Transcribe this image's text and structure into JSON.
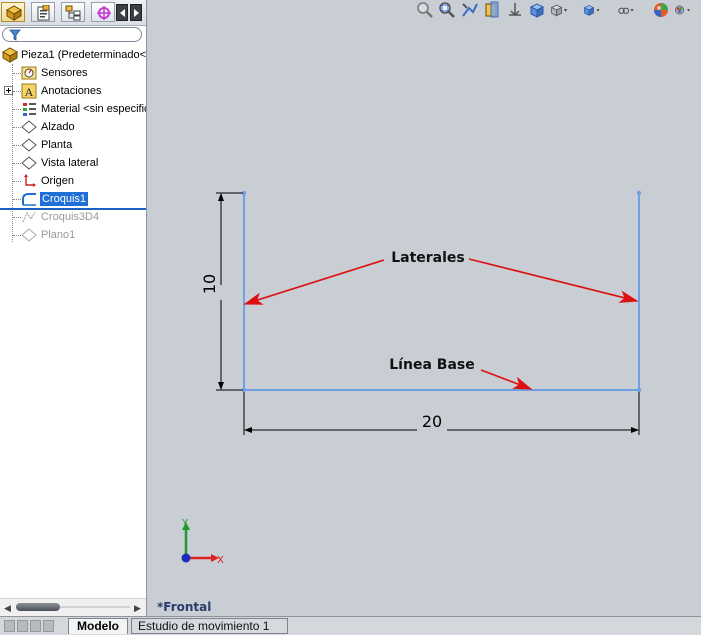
{
  "feature_tree": {
    "root": "Pieza1  (Predeterminado<",
    "items": [
      {
        "label": "Sensores",
        "icon": "sensor-icon",
        "state": "normal"
      },
      {
        "label": "Anotaciones",
        "icon": "annotations-icon",
        "state": "normal",
        "expandable": true
      },
      {
        "label": "Material <sin especific",
        "icon": "material-icon",
        "state": "normal"
      },
      {
        "label": "Alzado",
        "icon": "plane-icon",
        "state": "normal"
      },
      {
        "label": "Planta",
        "icon": "plane-icon",
        "state": "normal"
      },
      {
        "label": "Vista lateral",
        "icon": "plane-icon",
        "state": "normal"
      },
      {
        "label": "Origen",
        "icon": "origin-icon",
        "state": "normal"
      },
      {
        "label": "Croquis1",
        "icon": "sketch-icon",
        "state": "selected"
      },
      {
        "label": "Croquis3D4",
        "icon": "sketch3d-icon",
        "state": "suppressed"
      },
      {
        "label": "Plano1",
        "icon": "plane-icon",
        "state": "suppressed"
      }
    ]
  },
  "sketch": {
    "dim_vertical": "10",
    "dim_horizontal": "20",
    "annotation_laterales": "Laterales",
    "annotation_base": "Línea Base",
    "axis_y": "Y",
    "axis_x": "X",
    "line_color": "#6fa0e6",
    "arrow_color": "#dd1111"
  },
  "view_name": "*Frontal",
  "bottom_tabs": {
    "model": "Modelo",
    "motion_study": "Estudio de movimiento 1"
  },
  "toolbar_icons": [
    "zoom-fit-icon",
    "zoom-area-icon",
    "previous-view-icon",
    "section-view-icon",
    "dynamic-annotation-icon",
    "view-orientation-icon",
    "display-style-icon",
    "hide-show-icon",
    "edit-appearance-icon",
    "apply-scene-icon",
    "view-settings-icon"
  ]
}
